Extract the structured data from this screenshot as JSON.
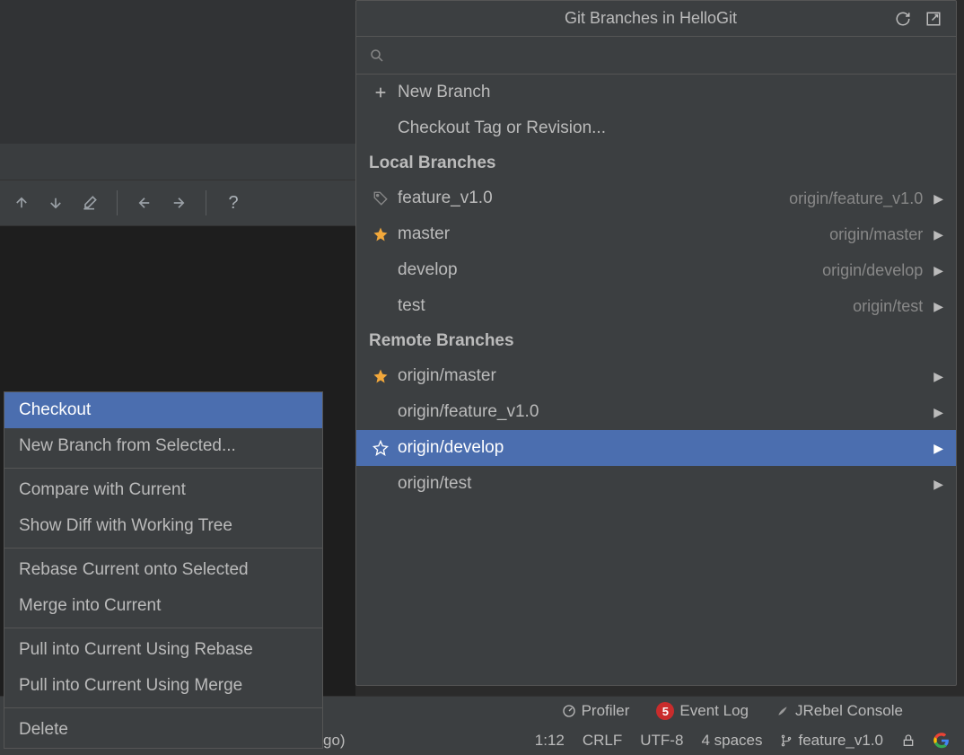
{
  "popup": {
    "title": "Git Branches in HelloGit",
    "search_placeholder": ""
  },
  "actions": {
    "new_branch": "New Branch",
    "checkout_tag": "Checkout Tag or Revision..."
  },
  "sections": {
    "local": "Local Branches",
    "remote": "Remote Branches"
  },
  "local_branches": [
    {
      "name": "feature_v1.0",
      "tracking": "origin/feature_v1.0",
      "icon": "tag"
    },
    {
      "name": "master",
      "tracking": "origin/master",
      "icon": "star"
    },
    {
      "name": "develop",
      "tracking": "origin/develop",
      "icon": ""
    },
    {
      "name": "test",
      "tracking": "origin/test",
      "icon": ""
    }
  ],
  "remote_branches": [
    {
      "name": "origin/master",
      "icon": "star"
    },
    {
      "name": "origin/feature_v1.0",
      "icon": ""
    },
    {
      "name": "origin/develop",
      "icon": "star-outline",
      "selected": true
    },
    {
      "name": "origin/test",
      "icon": ""
    }
  ],
  "context_menu": [
    {
      "label": "Checkout",
      "selected": true
    },
    {
      "label": "New Branch from Selected..."
    },
    {
      "divider": true
    },
    {
      "label": "Compare with Current"
    },
    {
      "label": "Show Diff with Working Tree"
    },
    {
      "divider": true
    },
    {
      "label": "Rebase Current onto Selected"
    },
    {
      "label": "Merge into Current"
    },
    {
      "divider": true
    },
    {
      "label": "Pull into Current Using Rebase"
    },
    {
      "label": "Pull into Current Using Merge"
    },
    {
      "divider": true
    },
    {
      "label": "Delete"
    }
  ],
  "status": {
    "profiler": "Profiler",
    "event_log": "Event Log",
    "event_count": "5",
    "jrebel": "JRebel Console",
    "go": "go)",
    "cursor": "1:12",
    "line_sep": "CRLF",
    "encoding": "UTF-8",
    "indent": "4 spaces",
    "git_branch": "feature_v1.0"
  }
}
